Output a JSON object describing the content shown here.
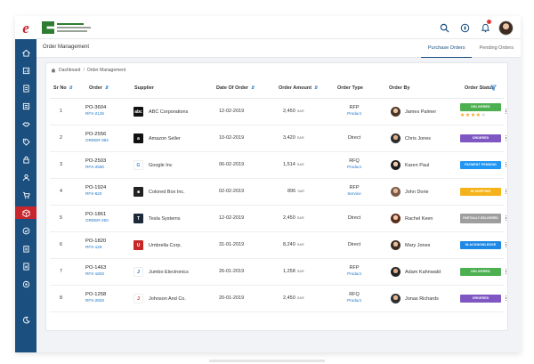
{
  "sidebar": {
    "logo_letter": "e",
    "accent": "#c7262c",
    "bg": "#1a4f7f",
    "icons": [
      "home-icon",
      "chart-icon",
      "document-icon",
      "list-icon",
      "handshake-icon",
      "tag-icon",
      "lock-icon",
      "user-icon",
      "cart-icon",
      "box-icon",
      "check-circle-icon",
      "clipboard-icon",
      "file-icon",
      "settings-icon",
      "moon-icon"
    ],
    "active_index": 9
  },
  "header": {
    "icons": [
      "search-icon",
      "compass-icon",
      "bell-icon"
    ]
  },
  "subheader": {
    "title": "Order Management",
    "tabs": [
      {
        "label": "Purchase Orders",
        "active": true
      },
      {
        "label": "Pending Orders",
        "active": false
      }
    ]
  },
  "breadcrumb": {
    "items": [
      "Dashboard",
      "Order Management"
    ]
  },
  "table": {
    "columns": [
      "Sr No",
      "Order",
      "Supplier",
      "Date Of Order",
      "Order Amount",
      "Order Type",
      "Order By",
      "Order Status"
    ],
    "rows": [
      {
        "sr": "1",
        "po": "PO-3604",
        "ref": "RFX-2125",
        "supplier": "ABC Corporations",
        "logo": "abc",
        "logo_color": "#111111",
        "date": "12-02-2019",
        "amount": "2,450",
        "unit": "SAR",
        "type": "RFP",
        "type_sub": "Product",
        "by": "James Palmer",
        "status": "DELIVERED",
        "status_color": "#4caf50",
        "rating": 4
      },
      {
        "sr": "2",
        "po": "PO-2556",
        "ref": "ORDER-384",
        "supplier": "Amazon Seller",
        "logo": "a",
        "logo_color": "#111111",
        "date": "10-02-2019",
        "amount": "3,420",
        "unit": "SAR",
        "type": "Direct",
        "type_sub": "",
        "by": "Chris Jones",
        "status": "ORDERED",
        "status_color": "#7e57c2",
        "rating": 0
      },
      {
        "sr": "3",
        "po": "PO-2503",
        "ref": "RFX-2560",
        "supplier": "Google Inc",
        "logo": "G",
        "logo_color": "#ffffff",
        "date": "06-02-2019",
        "amount": "1,514",
        "unit": "SAR",
        "type": "RFQ",
        "type_sub": "Product",
        "by": "Karen Paul",
        "status": "PAYMENT PENDING",
        "status_color": "#2196f3",
        "rating": 0
      },
      {
        "sr": "4",
        "po": "PO-1924",
        "ref": "RFX-620",
        "supplier": "Colored Box Inc.",
        "logo": "■",
        "logo_color": "#222222",
        "date": "02-02-2019",
        "amount": "896",
        "unit": "SAR",
        "type": "RFP",
        "type_sub": "Service",
        "by": "John Dorie",
        "status": "IN SHIPPING",
        "status_color": "#f5b31b",
        "rating": 0
      },
      {
        "sr": "5",
        "po": "PO-1861",
        "ref": "ORDER-250",
        "supplier": "Tesla Systems",
        "logo": "T",
        "logo_color": "#1c2a3a",
        "date": "12-02-2019",
        "amount": "2,450",
        "unit": "SAR",
        "type": "Direct",
        "type_sub": "",
        "by": "Rachel Keen",
        "status": "PARTIALLY DELIVERED",
        "status_color": "#9e9e9e",
        "rating": 0
      },
      {
        "sr": "6",
        "po": "PO-1820",
        "ref": "RFX-125",
        "supplier": "Umbrella Corp.",
        "logo": "U",
        "logo_color": "#c62828",
        "date": "31-01-2019",
        "amount": "8,240",
        "unit": "SAR",
        "type": "Direct",
        "type_sub": "",
        "by": "Mary Jones",
        "status": "IN ACKNOWLEDGE",
        "status_color": "#1e88e5",
        "rating": 0
      },
      {
        "sr": "7",
        "po": "PO-1463",
        "ref": "RFX-1803",
        "supplier": "Jumbo Electronics",
        "logo": "J",
        "logo_color": "#ffffff",
        "date": "26-01-2019",
        "amount": "1,258",
        "unit": "SAR",
        "type": "RFP",
        "type_sub": "Product",
        "by": "Adam Kahnwald",
        "status": "DELIVERED",
        "status_color": "#4caf50",
        "rating": 0
      },
      {
        "sr": "8",
        "po": "PO-1258",
        "ref": "RFX-2503",
        "supplier": "Johnson And Co.",
        "logo": "J",
        "logo_color": "#ffffff",
        "date": "20-01-2019",
        "amount": "2,450",
        "unit": "SAR",
        "type": "RFQ",
        "type_sub": "Product",
        "by": "Jonas Richards",
        "status": "ORDERED",
        "status_color": "#7e57c2",
        "rating": 0
      }
    ]
  }
}
